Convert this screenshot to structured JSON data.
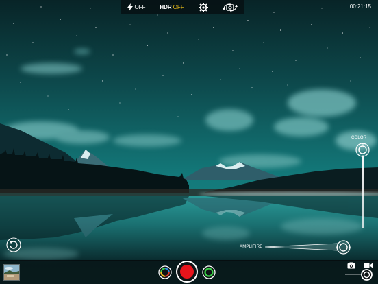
{
  "toolbar": {
    "flash": {
      "icon": "flash-icon",
      "value": "OFF"
    },
    "hdr": {
      "label": "HDR",
      "value": "OFF"
    },
    "settings": {
      "icon": "gear-icon"
    },
    "switch_camera": {
      "icon": "rotate-camera-icon"
    }
  },
  "timer": "00:21:15",
  "sliders": {
    "color": {
      "label": "COLOR"
    },
    "amplify": {
      "label": "AMPLIFIRE"
    }
  },
  "bottom": {
    "gallery": {
      "icon": "gallery-thumbnail"
    },
    "filter": {
      "icon": "filter-ring-icon"
    },
    "record": {
      "icon": "record-icon"
    },
    "effect": {
      "icon": "green-ring-icon"
    },
    "photo_mode": {
      "icon": "camera-icon"
    },
    "video_mode": {
      "icon": "video-camera-icon"
    },
    "mode": "video"
  },
  "colors": {
    "accent_hdr_off": "#f2c21a",
    "record_red": "#e8141b",
    "effect_green": "#3bd14a"
  }
}
